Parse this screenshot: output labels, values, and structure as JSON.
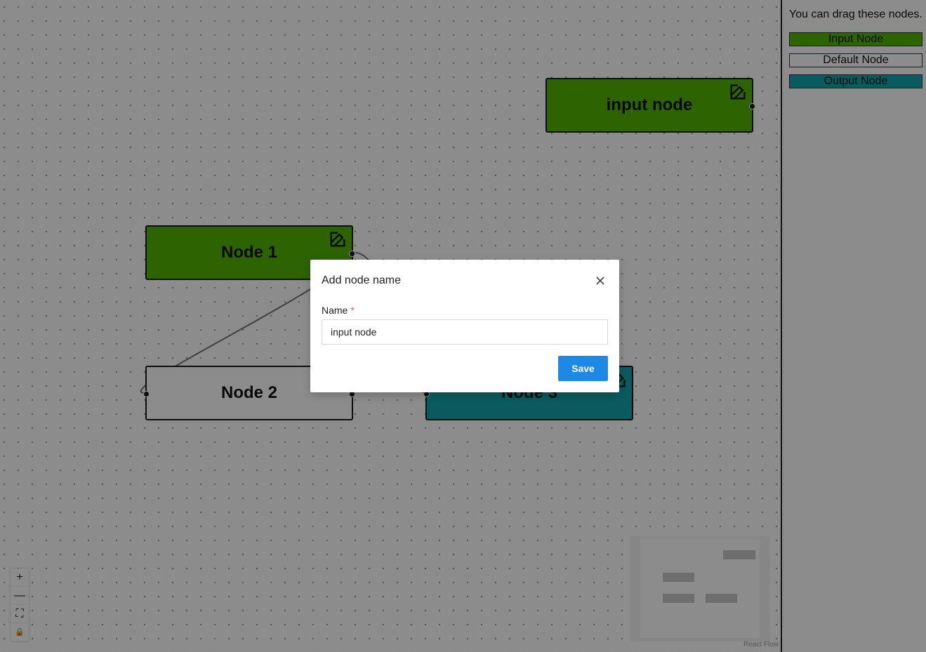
{
  "canvas": {
    "nodes": [
      {
        "label": "input node",
        "type": "input"
      },
      {
        "label": "Node 1",
        "type": "input"
      },
      {
        "label": "Node 2",
        "type": "default"
      },
      {
        "label": "Node 3",
        "type": "output"
      }
    ],
    "attribution": "React Flow"
  },
  "controls": {
    "zoom_in": "+",
    "zoom_out": "—",
    "fit_view": "⛶",
    "lock": "🔒"
  },
  "sidebar": {
    "description": "You can drag these nodes.",
    "items": [
      {
        "label": "Input Node",
        "type": "input"
      },
      {
        "label": "Default Node",
        "type": "default"
      },
      {
        "label": "Output Node",
        "type": "output"
      }
    ]
  },
  "modal": {
    "title": "Add node name",
    "field_label": "Name",
    "required_mark": "*",
    "field_value": "input node",
    "save_label": "Save"
  },
  "colors": {
    "input_node": "#52b400",
    "output_node": "#13a7ad",
    "primary_button": "#1e88e5"
  }
}
